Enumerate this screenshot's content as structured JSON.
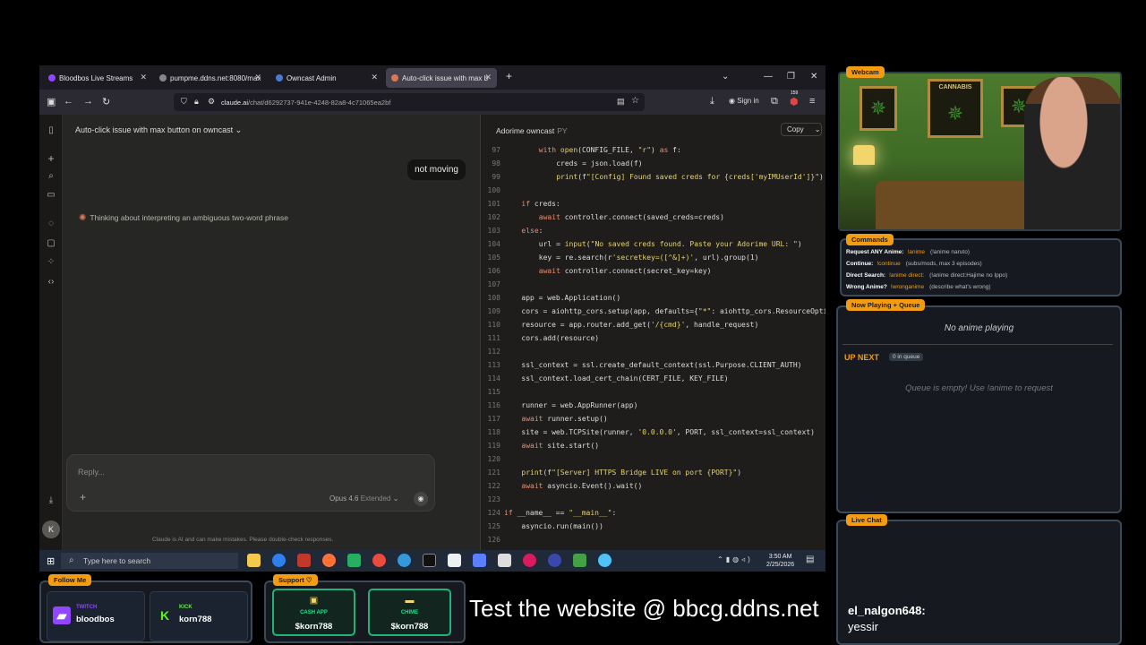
{
  "browser": {
    "tabs": [
      {
        "label": "Bloodbos Live Streams",
        "color": "#9146ff"
      },
      {
        "label": "pumpme.ddns.net:8080/max",
        "color": "#888888"
      },
      {
        "label": "Owncast Admin",
        "color": "#4a7bd0"
      },
      {
        "label": "Auto-click issue with max button",
        "color": "#d97757",
        "active": true
      }
    ],
    "url_host": "claude.ai",
    "url_path": "/chat/d6292737-941e-4248-82a8-4c71065ea2bf",
    "signin": "Sign in",
    "badge_count": "159"
  },
  "claude": {
    "chat_title": "Auto-click issue with max button on owncast",
    "user_message": "not moving",
    "thinking": "Thinking about interpreting an ambiguous two-word phrase",
    "reply_placeholder": "Reply...",
    "model": "Opus 4.6",
    "model_mode": "Extended",
    "disclaimer": "Claude is AI and can make mistakes. Please double-check responses.",
    "avatar_letter": "K"
  },
  "artifact": {
    "name": "Adorime owncast",
    "ext": "PY",
    "copy_label": "Copy",
    "lines": [
      {
        "n": "97",
        "indent": 8,
        "parts": [
          [
            "kw",
            "with "
          ],
          [
            "fn",
            "open"
          ],
          [
            "cl",
            "(CONFIG_FILE, "
          ],
          [
            "str",
            "\"r\""
          ],
          [
            "cl",
            ") "
          ],
          [
            "kw",
            "as"
          ],
          [
            "cl",
            " f:"
          ]
        ]
      },
      {
        "n": "98",
        "indent": 12,
        "parts": [
          [
            "cl",
            "creds = json.load(f)"
          ]
        ]
      },
      {
        "n": "99",
        "indent": 12,
        "parts": [
          [
            "fn",
            "print"
          ],
          [
            "cl",
            "(f"
          ],
          [
            "str",
            "\"[Config] Found saved creds for {creds['myIMUserId']}\""
          ],
          [
            "cl",
            ")"
          ]
        ]
      },
      {
        "n": "100",
        "indent": 0,
        "parts": []
      },
      {
        "n": "101",
        "indent": 4,
        "parts": [
          [
            "kw",
            "if"
          ],
          [
            "cl",
            " creds:"
          ]
        ]
      },
      {
        "n": "102",
        "indent": 8,
        "parts": [
          [
            "kw",
            "await"
          ],
          [
            "cl",
            " controller.connect(saved_creds=creds)"
          ]
        ]
      },
      {
        "n": "103",
        "indent": 4,
        "parts": [
          [
            "kw",
            "else"
          ],
          [
            "cl",
            ":"
          ]
        ]
      },
      {
        "n": "104",
        "indent": 8,
        "parts": [
          [
            "cl",
            "url = "
          ],
          [
            "fn",
            "input"
          ],
          [
            "cl",
            "("
          ],
          [
            "str",
            "\"No saved creds found. Paste your Adorime URL: \""
          ],
          [
            "cl",
            ")"
          ]
        ]
      },
      {
        "n": "105",
        "indent": 8,
        "parts": [
          [
            "cl",
            "key = re.search(r"
          ],
          [
            "str",
            "'secretkey=([^&]+)'"
          ],
          [
            "cl",
            ", url).group(1)"
          ]
        ]
      },
      {
        "n": "106",
        "indent": 8,
        "parts": [
          [
            "kw",
            "await"
          ],
          [
            "cl",
            " controller.connect(secret_key=key)"
          ]
        ]
      },
      {
        "n": "107",
        "indent": 0,
        "parts": []
      },
      {
        "n": "108",
        "indent": 4,
        "parts": [
          [
            "cl",
            "app = web.Application()"
          ]
        ]
      },
      {
        "n": "109",
        "indent": 4,
        "parts": [
          [
            "cl",
            "cors = aiohttp_cors.setup(app, defaults={"
          ],
          [
            "str",
            "\"*\""
          ],
          [
            "cl",
            ": aiohttp_cors.ResourceOptions(allo"
          ]
        ]
      },
      {
        "n": "110",
        "indent": 4,
        "parts": [
          [
            "cl",
            "resource = app.router.add_get("
          ],
          [
            "str",
            "'/{cmd}'"
          ],
          [
            "cl",
            ", handle_request)"
          ]
        ]
      },
      {
        "n": "111",
        "indent": 4,
        "parts": [
          [
            "cl",
            "cors.add(resource)"
          ]
        ]
      },
      {
        "n": "112",
        "indent": 0,
        "parts": []
      },
      {
        "n": "113",
        "indent": 4,
        "parts": [
          [
            "cl",
            "ssl_context = ssl.create_default_context(ssl.Purpose.CLIENT_AUTH)"
          ]
        ]
      },
      {
        "n": "114",
        "indent": 4,
        "parts": [
          [
            "cl",
            "ssl_context.load_cert_chain(CERT_FILE, KEY_FILE)"
          ]
        ]
      },
      {
        "n": "115",
        "indent": 0,
        "parts": []
      },
      {
        "n": "116",
        "indent": 4,
        "parts": [
          [
            "cl",
            "runner = web.AppRunner(app)"
          ]
        ]
      },
      {
        "n": "117",
        "indent": 4,
        "parts": [
          [
            "kw",
            "await"
          ],
          [
            "cl",
            " runner.setup()"
          ]
        ]
      },
      {
        "n": "118",
        "indent": 4,
        "parts": [
          [
            "cl",
            "site = web.TCPSite(runner, "
          ],
          [
            "str",
            "'0.0.0.0'"
          ],
          [
            "cl",
            ", PORT, ssl_context=ssl_context)"
          ]
        ]
      },
      {
        "n": "119",
        "indent": 4,
        "parts": [
          [
            "kw",
            "await"
          ],
          [
            "cl",
            " site.start()"
          ]
        ]
      },
      {
        "n": "120",
        "indent": 0,
        "parts": []
      },
      {
        "n": "121",
        "indent": 4,
        "parts": [
          [
            "fn",
            "print"
          ],
          [
            "cl",
            "(f"
          ],
          [
            "str",
            "\"[Server] HTTPS Bridge LIVE on port {PORT}\""
          ],
          [
            "cl",
            ")"
          ]
        ]
      },
      {
        "n": "122",
        "indent": 4,
        "parts": [
          [
            "kw",
            "await"
          ],
          [
            "cl",
            " asyncio.Event().wait()"
          ]
        ]
      },
      {
        "n": "123",
        "indent": 0,
        "parts": []
      },
      {
        "n": "124",
        "indent": 0,
        "parts": [
          [
            "kw",
            "if"
          ],
          [
            "cl",
            " __name__ == "
          ],
          [
            "str",
            "\"__main__\""
          ],
          [
            "cl",
            ":"
          ]
        ]
      },
      {
        "n": "125",
        "indent": 4,
        "parts": [
          [
            "cl",
            "asyncio.run(main())"
          ]
        ]
      },
      {
        "n": "126",
        "indent": 0,
        "parts": []
      }
    ]
  },
  "taskbar": {
    "search_placeholder": "Type here to search",
    "time": "3:50 AM",
    "date": "2/25/2026"
  },
  "overlay": {
    "webcam_title": "Webcam",
    "poster_label": "CANNABIS",
    "commands_title": "Commands",
    "commands": [
      {
        "label": "Request ANY Anime:",
        "cmd": "!anime",
        "desc": "(!anime naruto)"
      },
      {
        "label": "Continue:",
        "cmd": "!continue",
        "desc": "(subs/mods, max 3 episodes)"
      },
      {
        "label": "Direct Search:",
        "cmd": "!anime direct:",
        "desc": "(!anime direct:Hajime no Ippo)"
      },
      {
        "label": "Wrong Anime?",
        "cmd": "!wronganime",
        "desc": "(describe what's wrong)"
      }
    ],
    "nowplaying_title": "Now Playing + Queue",
    "no_anime": "No anime playing",
    "up_next": "UP NEXT",
    "queue_count": "0 in queue",
    "queue_empty": "Queue is empty! Use !anime to request",
    "livechat_title": "Live Chat",
    "chat_user": "el_nalgon648:",
    "chat_message": "yessir",
    "follow_title": "Follow Me",
    "follow": [
      {
        "platform": "TWITCH",
        "handle": "bloodbos",
        "color": "#9146ff",
        "icon": "twitch-icon",
        "glyph": "◥"
      },
      {
        "platform": "KICK",
        "handle": "korn788",
        "color": "#53fc18",
        "icon": "kick-icon",
        "glyph": "K"
      }
    ],
    "support_title": "Support",
    "support": [
      {
        "platform": "CASH APP",
        "handle": "$korn788",
        "icon": "cash-app-icon",
        "glyph": "$"
      },
      {
        "platform": "CHIME",
        "handle": "$korn788",
        "icon": "chime-card-icon",
        "glyph": "▬"
      }
    ],
    "banner": "Test the website @ bbcg.ddns.net"
  }
}
